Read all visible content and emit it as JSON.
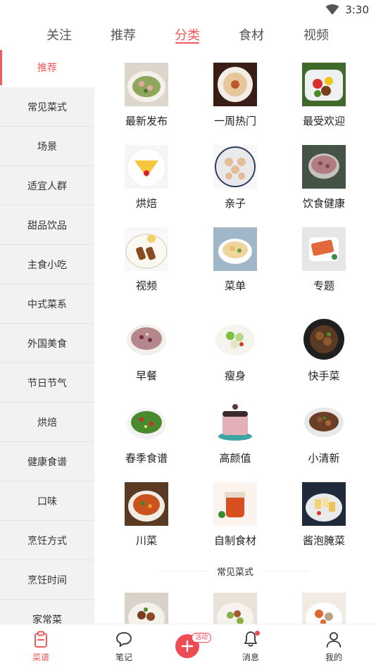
{
  "status_bar": {
    "time": "3:30",
    "icons": [
      "wifi-icon"
    ]
  },
  "top_tabs": [
    {
      "label": "关注",
      "active": false
    },
    {
      "label": "推荐",
      "active": false
    },
    {
      "label": "分类",
      "active": true
    },
    {
      "label": "食材",
      "active": false
    },
    {
      "label": "视频",
      "active": false
    }
  ],
  "sidebar": {
    "items": [
      {
        "label": "推荐",
        "active": true
      },
      {
        "label": "常见菜式"
      },
      {
        "label": "场景"
      },
      {
        "label": "适宜人群"
      },
      {
        "label": "甜品饮品"
      },
      {
        "label": "主食小吃"
      },
      {
        "label": "中式菜系"
      },
      {
        "label": "外国美食"
      },
      {
        "label": "节日节气"
      },
      {
        "label": "烘焙"
      },
      {
        "label": "健康食谱"
      },
      {
        "label": "口味"
      },
      {
        "label": "烹饪方式"
      },
      {
        "label": "烹饪时间"
      },
      {
        "label": "家常菜"
      }
    ]
  },
  "grid": {
    "items": [
      {
        "label": "最新发布",
        "image": "stirfry-plate-photo"
      },
      {
        "label": "一周热门",
        "image": "plated-appetizer-photo"
      },
      {
        "label": "最受欢迎",
        "image": "pepper-stirfry-photo"
      },
      {
        "label": "烘焙",
        "image": "cake-slice-photo"
      },
      {
        "label": "亲子",
        "image": "bear-buns-photo"
      },
      {
        "label": "饮食健康",
        "image": "grain-bowl-photo"
      },
      {
        "label": "视频",
        "image": "skewer-platter-photo"
      },
      {
        "label": "菜单",
        "image": "soup-bowl-photo"
      },
      {
        "label": "专题",
        "image": "sliced-dish-photo"
      },
      {
        "label": "早餐",
        "image": "porridge-bowl-photo"
      },
      {
        "label": "瘦身",
        "image": "veggie-salad-photo"
      },
      {
        "label": "快手菜",
        "image": "braised-dish-photo"
      },
      {
        "label": "春季食谱",
        "image": "greens-salad-photo"
      },
      {
        "label": "高颜值",
        "image": "layer-cake-photo"
      },
      {
        "label": "小清新",
        "image": "stew-bowl-photo"
      },
      {
        "label": "川菜",
        "image": "spicy-soup-photo"
      },
      {
        "label": "自制食材",
        "image": "jam-jar-photo"
      },
      {
        "label": "酱泡腌菜",
        "image": "pickled-radish-photo"
      }
    ],
    "section_title": "常见菜式",
    "section_thumbs": [
      "meat-stew-photo",
      "beans-dish-photo",
      "carrot-soup-photo"
    ]
  },
  "bottom_nav": {
    "items": [
      {
        "label": "菜谱",
        "icon": "clipboard-icon",
        "active": true
      },
      {
        "label": "笔记",
        "icon": "chat-bubble-icon"
      },
      {
        "label": "",
        "icon": "plus-icon",
        "badge": "活动"
      },
      {
        "label": "消息",
        "icon": "bell-icon",
        "dot": true
      },
      {
        "label": "我的",
        "icon": "person-icon"
      }
    ]
  },
  "colors": {
    "accent": "#ef5a5a",
    "sidebar_bg": "#f2f2f2",
    "publish": "#ef4b55"
  }
}
